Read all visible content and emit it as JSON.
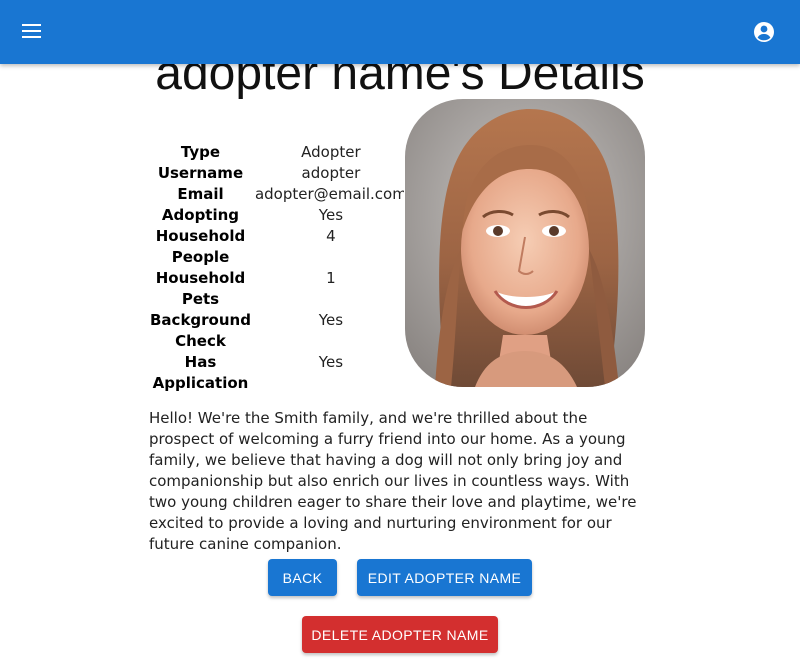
{
  "appbar": {
    "menu_icon": "menu-icon",
    "account_icon": "account-circle-icon",
    "color": "#1976d2"
  },
  "page": {
    "title": "adopter name's Details"
  },
  "details": [
    {
      "label": "Type",
      "value": "Adopter"
    },
    {
      "label": "Username",
      "value": "adopter"
    },
    {
      "label": "Email",
      "value": "adopter@email.com"
    },
    {
      "label": "Adopting",
      "value": "Yes"
    },
    {
      "label": "Household People",
      "value": "4"
    },
    {
      "label": "Household Pets",
      "value": "1"
    },
    {
      "label": "Background Check",
      "value": "Yes"
    },
    {
      "label": "Has Application",
      "value": "Yes"
    }
  ],
  "bio": "Hello! We're the Smith family, and we're thrilled about the prospect of welcoming a furry friend into our home. As a young family, we believe that having a dog will not only bring joy and companionship but also enrich our lives in countless ways. With two young children eager to share their love and playtime, we're excited to provide a loving and nurturing environment for our future canine companion.",
  "buttons": {
    "back": "BACK",
    "edit": "EDIT ADOPTER NAME",
    "delete": "DELETE ADOPTER NAME"
  },
  "colors": {
    "primary": "#1976d2",
    "danger": "#d32f2f"
  }
}
